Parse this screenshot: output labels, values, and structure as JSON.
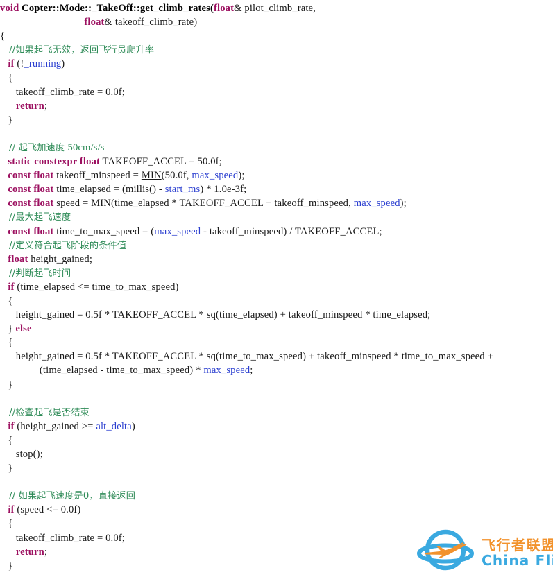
{
  "document": {
    "type": "source-code-listing",
    "language": "cpp",
    "background": "#ffffff"
  },
  "colors": {
    "keyword": "#9c1060",
    "comment": "#2e8b57",
    "identifier_blue": "#2b3fd0",
    "plain": "#1a1a1a",
    "logo_blue": "#3aa9e0",
    "logo_orange": "#f2922c"
  },
  "code": {
    "lines": [
      {
        "id": "l1",
        "tokens": [
          {
            "t": "kw",
            "v": "void "
          },
          {
            "t": "fn",
            "v": "Copter::Mode::_TakeOff::get_climb_rates("
          },
          {
            "t": "kw",
            "v": "float"
          },
          {
            "t": "plain",
            "v": "& pilot_climb_rate,"
          }
        ]
      },
      {
        "id": "l2",
        "tokens": [
          {
            "t": "plain",
            "v": "                                "
          },
          {
            "t": "kw",
            "v": "float"
          },
          {
            "t": "plain",
            "v": "& takeoff_climb_rate)"
          }
        ]
      },
      {
        "id": "l3",
        "tokens": [
          {
            "t": "plain",
            "v": "{"
          }
        ]
      },
      {
        "id": "l4",
        "tokens": [
          {
            "t": "cmt-cn",
            "v": "   //如果起飞无效，返回飞行员爬升率"
          }
        ]
      },
      {
        "id": "l5",
        "tokens": [
          {
            "t": "plain",
            "v": "   "
          },
          {
            "t": "kw",
            "v": "if"
          },
          {
            "t": "plain",
            "v": " (!"
          },
          {
            "t": "var",
            "v": "_running"
          },
          {
            "t": "plain",
            "v": ")"
          }
        ]
      },
      {
        "id": "l6",
        "tokens": [
          {
            "t": "plain",
            "v": "   {"
          }
        ]
      },
      {
        "id": "l7",
        "tokens": [
          {
            "t": "plain",
            "v": "      takeoff_climb_rate = 0.0f;"
          }
        ]
      },
      {
        "id": "l8",
        "tokens": [
          {
            "t": "plain",
            "v": "      "
          },
          {
            "t": "kw",
            "v": "return"
          },
          {
            "t": "plain",
            "v": ";"
          }
        ]
      },
      {
        "id": "l9",
        "tokens": [
          {
            "t": "plain",
            "v": "   }"
          }
        ]
      },
      {
        "id": "l10",
        "tokens": [
          {
            "t": "plain",
            "v": ""
          }
        ]
      },
      {
        "id": "l11",
        "tokens": [
          {
            "t": "cmt-cn",
            "v": "   // 起飞加速度 "
          },
          {
            "t": "cmt",
            "v": "50cm/s/s"
          }
        ]
      },
      {
        "id": "l12",
        "tokens": [
          {
            "t": "plain",
            "v": "   "
          },
          {
            "t": "kw",
            "v": "static constexpr float"
          },
          {
            "t": "plain",
            "v": " TAKEOFF_ACCEL = 50.0f;"
          }
        ]
      },
      {
        "id": "l13",
        "tokens": [
          {
            "t": "plain",
            "v": "   "
          },
          {
            "t": "kw",
            "v": "const float"
          },
          {
            "t": "plain",
            "v": " takeoff_minspeed = "
          },
          {
            "t": "macro",
            "v": "MIN"
          },
          {
            "t": "plain",
            "v": "(50.0f, "
          },
          {
            "t": "var",
            "v": "max_speed"
          },
          {
            "t": "plain",
            "v": ");"
          }
        ]
      },
      {
        "id": "l14",
        "tokens": [
          {
            "t": "plain",
            "v": "   "
          },
          {
            "t": "kw",
            "v": "const float"
          },
          {
            "t": "plain",
            "v": " time_elapsed = (millis() - "
          },
          {
            "t": "var",
            "v": "start_ms"
          },
          {
            "t": "plain",
            "v": ") * 1.0e-3f;"
          }
        ]
      },
      {
        "id": "l15",
        "tokens": [
          {
            "t": "plain",
            "v": "   "
          },
          {
            "t": "kw",
            "v": "const float"
          },
          {
            "t": "plain",
            "v": " speed = "
          },
          {
            "t": "macro",
            "v": "MIN"
          },
          {
            "t": "plain",
            "v": "(time_elapsed * TAKEOFF_ACCEL + takeoff_minspeed, "
          },
          {
            "t": "var",
            "v": "max_speed"
          },
          {
            "t": "plain",
            "v": ");"
          }
        ]
      },
      {
        "id": "l16",
        "tokens": [
          {
            "t": "cmt-cn",
            "v": "   //最大起飞速度"
          }
        ]
      },
      {
        "id": "l17",
        "tokens": [
          {
            "t": "plain",
            "v": "   "
          },
          {
            "t": "kw",
            "v": "const float"
          },
          {
            "t": "plain",
            "v": " time_to_max_speed = ("
          },
          {
            "t": "var",
            "v": "max_speed"
          },
          {
            "t": "plain",
            "v": " - takeoff_minspeed) / TAKEOFF_ACCEL;"
          }
        ]
      },
      {
        "id": "l18",
        "tokens": [
          {
            "t": "cmt-cn",
            "v": "   //定义符合起飞阶段的条件值"
          }
        ]
      },
      {
        "id": "l19",
        "tokens": [
          {
            "t": "plain",
            "v": "   "
          },
          {
            "t": "kw",
            "v": "float"
          },
          {
            "t": "plain",
            "v": " height_gained;"
          }
        ]
      },
      {
        "id": "l20",
        "tokens": [
          {
            "t": "cmt-cn",
            "v": "   //判断起飞时间"
          }
        ]
      },
      {
        "id": "l21",
        "tokens": [
          {
            "t": "plain",
            "v": "   "
          },
          {
            "t": "kw",
            "v": "if"
          },
          {
            "t": "plain",
            "v": " (time_elapsed <= time_to_max_speed)"
          }
        ]
      },
      {
        "id": "l22",
        "tokens": [
          {
            "t": "plain",
            "v": "   {"
          }
        ]
      },
      {
        "id": "l23",
        "tokens": [
          {
            "t": "plain",
            "v": "      height_gained = 0.5f * TAKEOFF_ACCEL * sq(time_elapsed) + takeoff_minspeed * time_elapsed;"
          }
        ]
      },
      {
        "id": "l24",
        "tokens": [
          {
            "t": "plain",
            "v": "   } "
          },
          {
            "t": "kw",
            "v": "else"
          }
        ]
      },
      {
        "id": "l25",
        "tokens": [
          {
            "t": "plain",
            "v": "   {"
          }
        ]
      },
      {
        "id": "l26",
        "tokens": [
          {
            "t": "plain",
            "v": "      height_gained = 0.5f * TAKEOFF_ACCEL * sq(time_to_max_speed) + takeoff_minspeed * time_to_max_speed +"
          }
        ]
      },
      {
        "id": "l27",
        "tokens": [
          {
            "t": "plain",
            "v": "               (time_elapsed - time_to_max_speed) * "
          },
          {
            "t": "var",
            "v": "max_speed"
          },
          {
            "t": "plain",
            "v": ";"
          }
        ]
      },
      {
        "id": "l28",
        "tokens": [
          {
            "t": "plain",
            "v": "   }"
          }
        ]
      },
      {
        "id": "l29",
        "tokens": [
          {
            "t": "plain",
            "v": ""
          }
        ]
      },
      {
        "id": "l30",
        "tokens": [
          {
            "t": "cmt-cn",
            "v": "   //检查起飞是否结束"
          }
        ]
      },
      {
        "id": "l31",
        "tokens": [
          {
            "t": "plain",
            "v": "   "
          },
          {
            "t": "kw",
            "v": "if"
          },
          {
            "t": "plain",
            "v": " (height_gained >= "
          },
          {
            "t": "var",
            "v": "alt_delta"
          },
          {
            "t": "plain",
            "v": ")"
          }
        ]
      },
      {
        "id": "l32",
        "tokens": [
          {
            "t": "plain",
            "v": "   {"
          }
        ]
      },
      {
        "id": "l33",
        "tokens": [
          {
            "t": "plain",
            "v": "      stop();"
          }
        ]
      },
      {
        "id": "l34",
        "tokens": [
          {
            "t": "plain",
            "v": "   }"
          }
        ]
      },
      {
        "id": "l35",
        "tokens": [
          {
            "t": "plain",
            "v": ""
          }
        ]
      },
      {
        "id": "l36",
        "tokens": [
          {
            "t": "cmt-cn",
            "v": "   // 如果起飞速度是0，直接返回"
          }
        ]
      },
      {
        "id": "l37",
        "tokens": [
          {
            "t": "plain",
            "v": "   "
          },
          {
            "t": "kw",
            "v": "if"
          },
          {
            "t": "plain",
            "v": " (speed <= 0.0f)"
          }
        ]
      },
      {
        "id": "l38",
        "tokens": [
          {
            "t": "plain",
            "v": "   {"
          }
        ]
      },
      {
        "id": "l39",
        "tokens": [
          {
            "t": "plain",
            "v": "      takeoff_climb_rate = 0.0f;"
          }
        ]
      },
      {
        "id": "l40",
        "tokens": [
          {
            "t": "plain",
            "v": "      "
          },
          {
            "t": "kw",
            "v": "return"
          },
          {
            "t": "plain",
            "v": ";"
          }
        ]
      },
      {
        "id": "l41",
        "tokens": [
          {
            "t": "plain",
            "v": "   }"
          }
        ]
      }
    ]
  },
  "watermark": {
    "name": "china-flier-logo",
    "title_cn": "飞行者联盟",
    "title_en": "China Flier",
    "mark_color": "#3aa9e0",
    "plane_color": "#f2922c"
  }
}
